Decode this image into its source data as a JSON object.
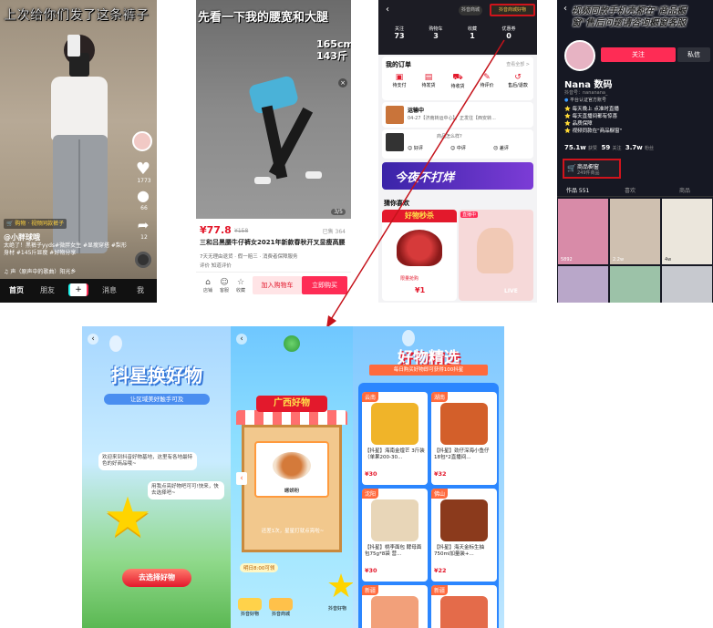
{
  "p1": {
    "caption": "上次给你们发了这条裤子",
    "likes": "1773",
    "comments": "66",
    "shares": "12",
    "product_tag": "购物 · 视频同款裤子",
    "user": "@小胖球哦",
    "desc": "太绝了！黑裤子yyds#微胖女生 #显瘦穿搭 #梨形身材 #145斤显瘦 #好物分享",
    "music": "声（原声中的歌曲）阳光乡",
    "tabs": [
      "首页",
      "朋友",
      "+",
      "消息",
      "我"
    ]
  },
  "p2": {
    "caption": "先看一下我的腰宽和大腿",
    "stats": "165cm 143斤",
    "counter": "3/5",
    "price": "¥77.8",
    "orig_price": "¥158",
    "sold": "已售 364",
    "title": "三和吕黑腰牛仔裤女2021年新款春秋开叉显瘦高腰",
    "service": "7天无理由退货 · 假一赔三 · 消费者保障服务",
    "review": "评价 知道评价",
    "actions": [
      "店铺",
      "客服",
      "收藏"
    ],
    "add_cart": "加入购物车",
    "buy_now": "立即购买"
  },
  "p3": {
    "shop_badge": "抖音商城",
    "header_btn": "抖音商城好物",
    "stats": [
      {
        "value": "73",
        "label": "关注"
      },
      {
        "value": "3",
        "label": "购物车"
      },
      {
        "value": "1",
        "label": "收藏"
      },
      {
        "value": "0",
        "label": "优惠券"
      }
    ],
    "orders_title": "我的订单",
    "orders_all": "查看全部 >",
    "order_icons": [
      "待支付",
      "待发货",
      "待收货",
      "待评价",
      "售后/退款"
    ],
    "shipping": "运输中",
    "shipping_time": "04-27【济南转运中心】，正发往【西安转...",
    "review_q": "商品怎么样?",
    "review_opts": [
      "好评",
      "中评",
      "差评"
    ],
    "banner": "今夜不打烊",
    "guess": "猜你喜欢",
    "card1": "好物秒杀",
    "card2": "直播中",
    "card_price": "¥1",
    "card_sold": "限量抢购",
    "card_live": "LIVE"
  },
  "p4": {
    "bubble": "视频同款手机壳都在\"商品橱窗\"售后问题请咨询橱窗客服",
    "follow": "关注",
    "message": "私信",
    "name": "Nana 数码",
    "id": "抖音号：nananana_",
    "badge": "平台认证官方账号",
    "bio": [
      "每天晚上 点准时直播",
      "每天直播间都有惊喜",
      "品质保障",
      "视频同款在\"商品橱窗\""
    ],
    "followers": "75.1w",
    "followers_lbl": "获赞",
    "following": "59",
    "following_lbl": "关注",
    "fans": "3.7w",
    "fans_lbl": "粉丝",
    "shop": "商品橱窗",
    "shop_count": "249件商品",
    "tabs": [
      "作品 551",
      "喜欢",
      "商品"
    ],
    "video_views": [
      "5892",
      "2.2w",
      "4w",
      "",
      "",
      ""
    ]
  },
  "p5": {
    "title": "抖星换好物",
    "subtitle": "让区域美好触手可及",
    "bubble1": "欢迎来到抖音好物基地，这里有各地最特色的好商品哦~",
    "bubble2": "用我点亮好物吧可可!快来，快去选择吧~",
    "button": "去选择好物"
  },
  "p6": {
    "title": "广西好物",
    "goods_label": "螺蛳粉",
    "notice": "还差1次，星星打就点亮啦~",
    "countdown": "明日8:00可领",
    "buttons": [
      "抖音好物",
      "抖音商城",
      "抖音好物"
    ]
  },
  "p7": {
    "title": "好物精选",
    "subtitle": "每日购买好物即可获得100抖星",
    "items": [
      {
        "tag": "云南",
        "name": "【抖星】海南金煌芒 3斤装（单果200-30...",
        "price": "¥30"
      },
      {
        "tag": "湖南",
        "name": "【抖星】劲仔深海小鱼仔18包*2直播间...",
        "price": "¥32"
      },
      {
        "tag": "沈阳",
        "name": "【抖星】桃李面包 酵母面包75g*8袋 营...",
        "price": "¥30"
      },
      {
        "tag": "佛山",
        "name": "【抖星】海天金标生抽750ml加量装+...",
        "price": "¥22"
      },
      {
        "tag": "新疆",
        "name": "",
        "price": ""
      },
      {
        "tag": "新疆",
        "name": "",
        "price": ""
      }
    ]
  },
  "colors": {
    "accent": "#fe2c55",
    "gold": "#f5c24a",
    "douyin_dark": "#161823",
    "red": "#e3192c",
    "arrow": "#c5131b"
  }
}
